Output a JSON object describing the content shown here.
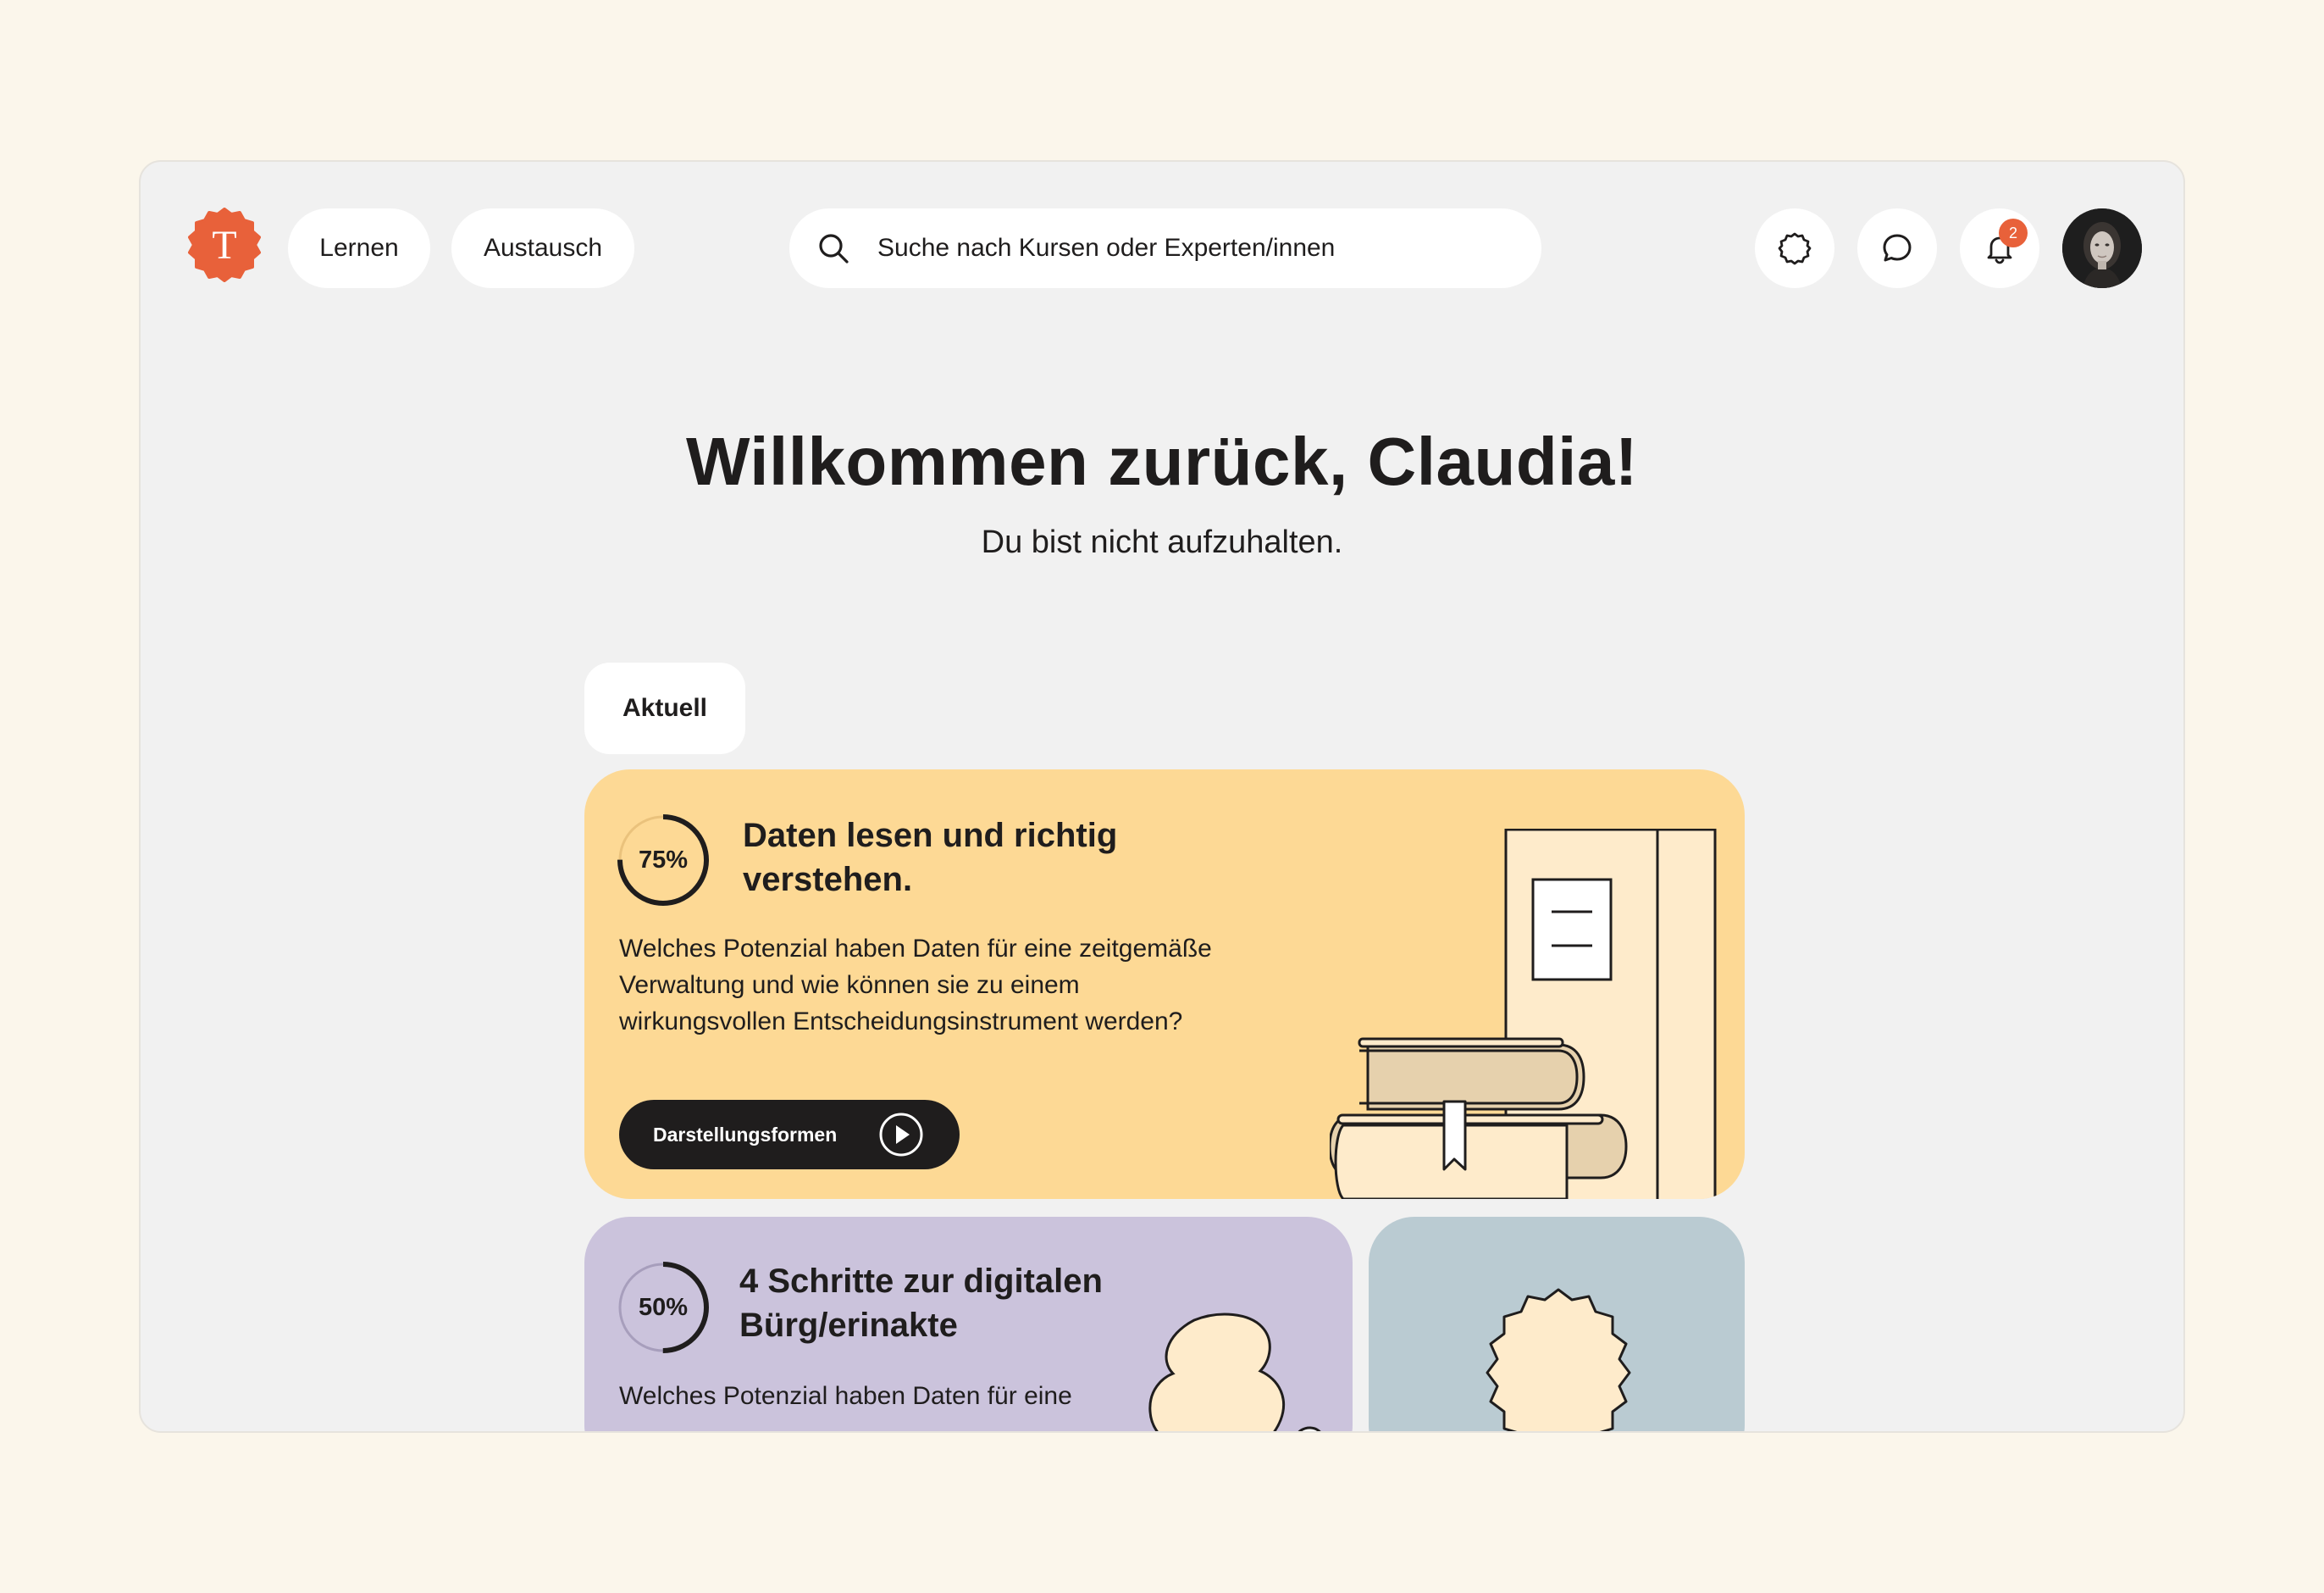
{
  "nav": {
    "logo_letter": "T",
    "items": [
      {
        "label": "Lernen"
      },
      {
        "label": "Austausch"
      }
    ]
  },
  "search": {
    "placeholder": "Suche nach Kursen oder Experten/innen",
    "icon": "search-icon"
  },
  "actions": {
    "help_icon": "help-badge-icon",
    "chat_icon": "chat-bubble-icon",
    "bell_icon": "bell-icon",
    "notification_count": "2"
  },
  "hero": {
    "title": "Willkommen zurück, Claudia!",
    "subtitle": "Du bist nicht aufzuhalten."
  },
  "tabs": {
    "current": "Aktuell"
  },
  "courses": [
    {
      "progress_label": "75%",
      "progress": 0.75,
      "title_line1": "Daten lesen und richtig",
      "title_line2": "verstehen.",
      "desc_line1": "Welches Potenzial haben Daten für eine zeitgemäße",
      "desc_line2": "Verwaltung und wie können sie zu einem",
      "desc_line3": "wirkungsvollen Entscheidungsinstrument werden?",
      "cta_label": "Darstellungsformen",
      "color": "#FDD995"
    },
    {
      "progress_label": "50%",
      "progress": 0.5,
      "title_line1": "4 Schritte zur digitalen",
      "title_line2": "Bürg/erinakte",
      "desc_line1": "Welches Potenzial haben Daten für eine",
      "color": "#CBC3DC"
    },
    {
      "color": "#BACBD2"
    }
  ],
  "colors": {
    "brand": "#E8613A",
    "background": "#FBF6EB",
    "panel": "#F1F1F1",
    "text": "#1F1D1D"
  }
}
